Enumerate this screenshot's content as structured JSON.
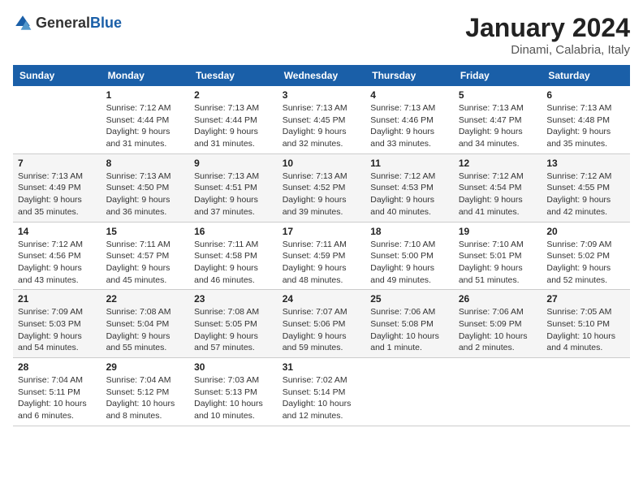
{
  "header": {
    "logo": {
      "general": "General",
      "blue": "Blue"
    },
    "title": "January 2024",
    "location": "Dinami, Calabria, Italy"
  },
  "weekdays": [
    "Sunday",
    "Monday",
    "Tuesday",
    "Wednesday",
    "Thursday",
    "Friday",
    "Saturday"
  ],
  "weeks": [
    [
      {
        "day": "",
        "info": ""
      },
      {
        "day": "1",
        "info": "Sunrise: 7:12 AM\nSunset: 4:44 PM\nDaylight: 9 hours\nand 31 minutes."
      },
      {
        "day": "2",
        "info": "Sunrise: 7:13 AM\nSunset: 4:44 PM\nDaylight: 9 hours\nand 31 minutes."
      },
      {
        "day": "3",
        "info": "Sunrise: 7:13 AM\nSunset: 4:45 PM\nDaylight: 9 hours\nand 32 minutes."
      },
      {
        "day": "4",
        "info": "Sunrise: 7:13 AM\nSunset: 4:46 PM\nDaylight: 9 hours\nand 33 minutes."
      },
      {
        "day": "5",
        "info": "Sunrise: 7:13 AM\nSunset: 4:47 PM\nDaylight: 9 hours\nand 34 minutes."
      },
      {
        "day": "6",
        "info": "Sunrise: 7:13 AM\nSunset: 4:48 PM\nDaylight: 9 hours\nand 35 minutes."
      }
    ],
    [
      {
        "day": "7",
        "info": "Sunrise: 7:13 AM\nSunset: 4:49 PM\nDaylight: 9 hours\nand 35 minutes."
      },
      {
        "day": "8",
        "info": "Sunrise: 7:13 AM\nSunset: 4:50 PM\nDaylight: 9 hours\nand 36 minutes."
      },
      {
        "day": "9",
        "info": "Sunrise: 7:13 AM\nSunset: 4:51 PM\nDaylight: 9 hours\nand 37 minutes."
      },
      {
        "day": "10",
        "info": "Sunrise: 7:13 AM\nSunset: 4:52 PM\nDaylight: 9 hours\nand 39 minutes."
      },
      {
        "day": "11",
        "info": "Sunrise: 7:12 AM\nSunset: 4:53 PM\nDaylight: 9 hours\nand 40 minutes."
      },
      {
        "day": "12",
        "info": "Sunrise: 7:12 AM\nSunset: 4:54 PM\nDaylight: 9 hours\nand 41 minutes."
      },
      {
        "day": "13",
        "info": "Sunrise: 7:12 AM\nSunset: 4:55 PM\nDaylight: 9 hours\nand 42 minutes."
      }
    ],
    [
      {
        "day": "14",
        "info": "Sunrise: 7:12 AM\nSunset: 4:56 PM\nDaylight: 9 hours\nand 43 minutes."
      },
      {
        "day": "15",
        "info": "Sunrise: 7:11 AM\nSunset: 4:57 PM\nDaylight: 9 hours\nand 45 minutes."
      },
      {
        "day": "16",
        "info": "Sunrise: 7:11 AM\nSunset: 4:58 PM\nDaylight: 9 hours\nand 46 minutes."
      },
      {
        "day": "17",
        "info": "Sunrise: 7:11 AM\nSunset: 4:59 PM\nDaylight: 9 hours\nand 48 minutes."
      },
      {
        "day": "18",
        "info": "Sunrise: 7:10 AM\nSunset: 5:00 PM\nDaylight: 9 hours\nand 49 minutes."
      },
      {
        "day": "19",
        "info": "Sunrise: 7:10 AM\nSunset: 5:01 PM\nDaylight: 9 hours\nand 51 minutes."
      },
      {
        "day": "20",
        "info": "Sunrise: 7:09 AM\nSunset: 5:02 PM\nDaylight: 9 hours\nand 52 minutes."
      }
    ],
    [
      {
        "day": "21",
        "info": "Sunrise: 7:09 AM\nSunset: 5:03 PM\nDaylight: 9 hours\nand 54 minutes."
      },
      {
        "day": "22",
        "info": "Sunrise: 7:08 AM\nSunset: 5:04 PM\nDaylight: 9 hours\nand 55 minutes."
      },
      {
        "day": "23",
        "info": "Sunrise: 7:08 AM\nSunset: 5:05 PM\nDaylight: 9 hours\nand 57 minutes."
      },
      {
        "day": "24",
        "info": "Sunrise: 7:07 AM\nSunset: 5:06 PM\nDaylight: 9 hours\nand 59 minutes."
      },
      {
        "day": "25",
        "info": "Sunrise: 7:06 AM\nSunset: 5:08 PM\nDaylight: 10 hours\nand 1 minute."
      },
      {
        "day": "26",
        "info": "Sunrise: 7:06 AM\nSunset: 5:09 PM\nDaylight: 10 hours\nand 2 minutes."
      },
      {
        "day": "27",
        "info": "Sunrise: 7:05 AM\nSunset: 5:10 PM\nDaylight: 10 hours\nand 4 minutes."
      }
    ],
    [
      {
        "day": "28",
        "info": "Sunrise: 7:04 AM\nSunset: 5:11 PM\nDaylight: 10 hours\nand 6 minutes."
      },
      {
        "day": "29",
        "info": "Sunrise: 7:04 AM\nSunset: 5:12 PM\nDaylight: 10 hours\nand 8 minutes."
      },
      {
        "day": "30",
        "info": "Sunrise: 7:03 AM\nSunset: 5:13 PM\nDaylight: 10 hours\nand 10 minutes."
      },
      {
        "day": "31",
        "info": "Sunrise: 7:02 AM\nSunset: 5:14 PM\nDaylight: 10 hours\nand 12 minutes."
      },
      {
        "day": "",
        "info": ""
      },
      {
        "day": "",
        "info": ""
      },
      {
        "day": "",
        "info": ""
      }
    ]
  ]
}
